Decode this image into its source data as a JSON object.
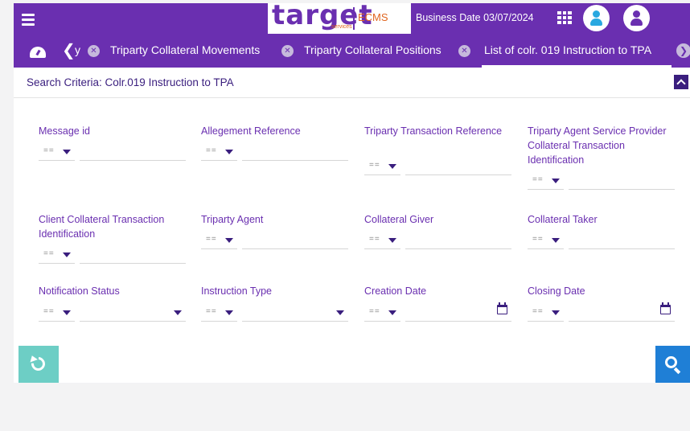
{
  "header": {
    "logo_word": "target",
    "logo_sub": "services",
    "logo_ecms": "ECMS",
    "business_date": "Business Date 03/07/2024"
  },
  "tabs": [
    {
      "label": "y",
      "closable": true
    },
    {
      "label": "Triparty Collateral Movements",
      "closable": true
    },
    {
      "label": "Triparty Collateral Positions",
      "closable": true
    },
    {
      "label": "List of colr. 019 Instruction to TPA",
      "closable": true,
      "active": true
    }
  ],
  "criteria": {
    "title": "Search Criteria: Colr.019 Instruction to TPA",
    "operator": "==",
    "fields": [
      {
        "label": "Message id"
      },
      {
        "label": "Allegement Reference"
      },
      {
        "label": "Triparty Transaction Reference"
      },
      {
        "label": "Triparty Agent Service Provider Collateral Transaction Identification"
      },
      {
        "label": "Client Collateral Transaction Identification"
      },
      {
        "label": "Triparty Agent"
      },
      {
        "label": "Collateral Giver"
      },
      {
        "label": "Collateral Taker"
      },
      {
        "label": "Notification Status"
      },
      {
        "label": "Instruction Type"
      },
      {
        "label": "Creation Date"
      },
      {
        "label": "Closing Date"
      }
    ]
  },
  "colors": {
    "brand_purple": "#6a2fb0",
    "dark_purple": "#3a1e7e",
    "reset_teal": "#6dcec5",
    "search_blue": "#1f7fd6",
    "accent_orange": "#e0651f"
  },
  "icons": [
    "menu-icon",
    "apps-grid-icon",
    "user-icon",
    "dashboard-icon",
    "chevron-left-icon",
    "close-icon",
    "chevron-right-icon",
    "collapse-icon",
    "calendar-icon",
    "reset-icon",
    "search-icon"
  ]
}
